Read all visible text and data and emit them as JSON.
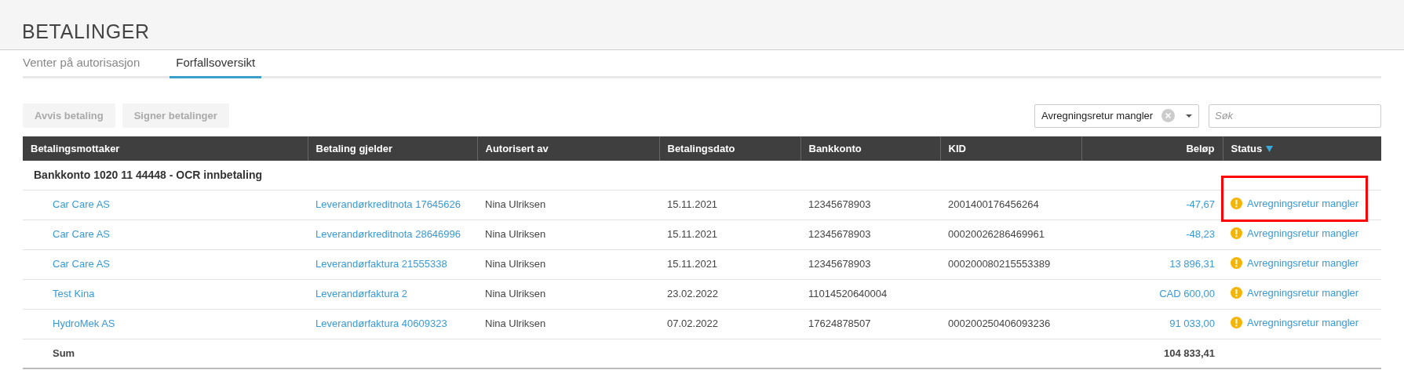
{
  "page_title": "BETALINGER",
  "tabs": [
    {
      "label": "Venter på autorisasjon",
      "selected": false
    },
    {
      "label": "Forfallsoversikt",
      "selected": true
    }
  ],
  "actions": [
    {
      "label": "Avvis betaling",
      "disabled": true
    },
    {
      "label": "Signer betalinger",
      "disabled": true
    }
  ],
  "status_filter": {
    "value": "Avregningsretur mangler"
  },
  "search": {
    "placeholder": "Søk"
  },
  "table": {
    "columns": [
      {
        "label": "Betalingsmottaker",
        "sorted": false
      },
      {
        "label": "Betaling gjelder",
        "sorted": false
      },
      {
        "label": "Autorisert av",
        "sorted": false
      },
      {
        "label": "Betalingsdato",
        "sorted": false
      },
      {
        "label": "Bankkonto",
        "sorted": false
      },
      {
        "label": "KID",
        "sorted": false
      },
      {
        "label": "Beløp",
        "sorted": false
      },
      {
        "label": "Status",
        "sorted": true
      }
    ],
    "group": "Bankkonto 1020 11 44448 - OCR innbetaling",
    "rows": [
      {
        "payee": "Car Care AS",
        "concerns": "Leverandørkreditnota 17645626",
        "authorized_by": "Nina Ulriksen",
        "date": "15.11.2021",
        "account": "12345678903",
        "kid": "2001400176456264",
        "amount": "-47,67",
        "status": "Avregningsretur mangler",
        "highlighted": true
      },
      {
        "payee": "Car Care AS",
        "concerns": "Leverandørkreditnota 28646996",
        "authorized_by": "Nina Ulriksen",
        "date": "15.11.2021",
        "account": "12345678903",
        "kid": "00020026286469961",
        "amount": "-48,23",
        "status": "Avregningsretur mangler",
        "highlighted": false
      },
      {
        "payee": "Car Care AS",
        "concerns": "Leverandørfaktura 21555338",
        "authorized_by": "Nina Ulriksen",
        "date": "15.11.2021",
        "account": "12345678903",
        "kid": "000200080215553389",
        "amount": "13 896,31",
        "status": "Avregningsretur mangler",
        "highlighted": false
      },
      {
        "payee": "Test Kina",
        "concerns": "Leverandørfaktura 2",
        "authorized_by": "Nina Ulriksen",
        "date": "23.02.2022",
        "account": "11014520640004",
        "amount": "CAD 600,00",
        "status": "Avregningsretur mangler",
        "highlighted": false
      },
      {
        "payee": "HydroMek AS",
        "concerns": "Leverandørfaktura 40609323",
        "authorized_by": "Nina Ulriksen",
        "date": "07.02.2022",
        "account": "17624878507",
        "kid": "000200250406093236",
        "amount": "91 033,00",
        "status": "Avregningsretur mangler",
        "highlighted": false
      }
    ],
    "sum": {
      "label": "Sum",
      "amount": "104 833,41"
    }
  }
}
